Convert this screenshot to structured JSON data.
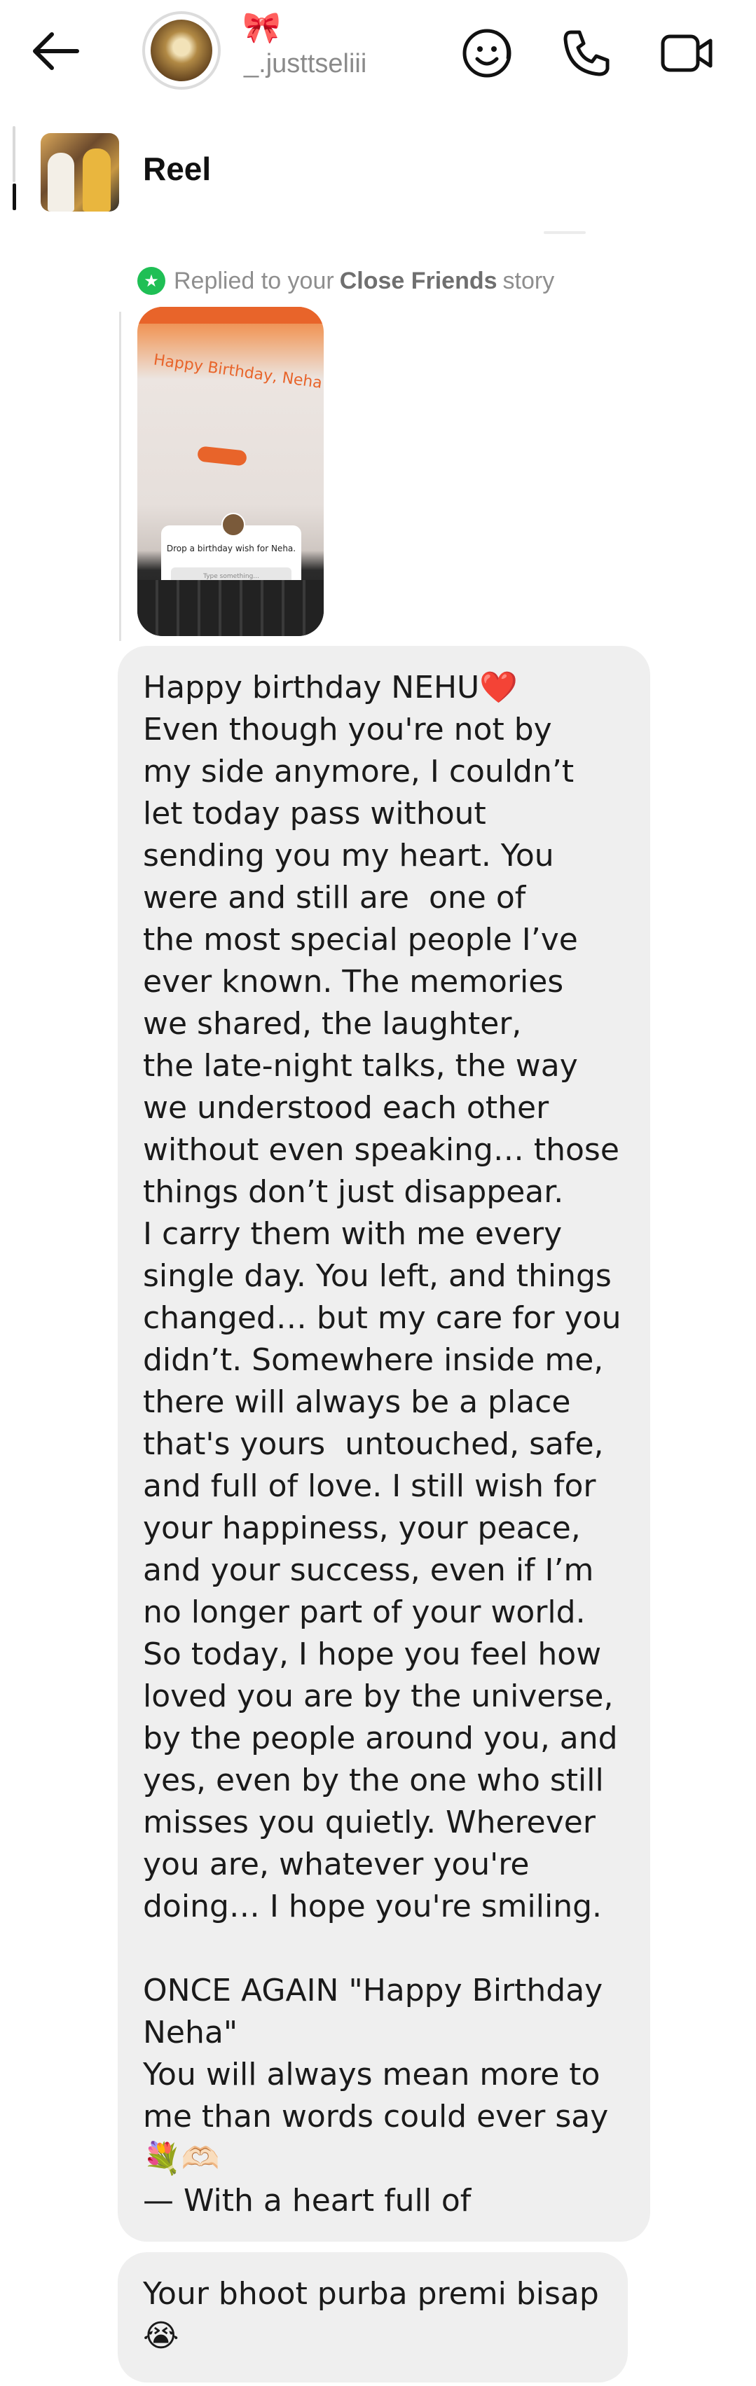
{
  "header": {
    "username": "_.justtseliii",
    "name_emoji": "🎀"
  },
  "reel_preview": {
    "label": "Reel"
  },
  "reply_context": {
    "prefix": "Replied to your",
    "highlight": "Close Friends",
    "suffix": "story",
    "badge_icon": "★"
  },
  "story_thumbnail": {
    "headline": "Happy Birthday, Neha ❤",
    "card_text": "Drop a birthday wish for Neha.",
    "card_placeholder": "Type something..."
  },
  "messages": [
    {
      "text": "Happy birthday NEHU❤️\nEven though you're not by\nmy side anymore, I couldn’t\nlet today pass without\nsending you my heart. You\nwere and still are  one of\nthe most special people I’ve\never known. The memories\nwe shared, the laughter,\nthe late-night talks, the way\nwe understood each other\nwithout even speaking… those\nthings don’t just disappear.\nI carry them with me every\nsingle day. You left, and things\nchanged… but my care for you\ndidn’t. Somewhere inside me,\nthere will always be a place\nthat's yours  untouched, safe,\nand full of love. I still wish for\nyour happiness, your peace,\nand your success, even if I’m\nno longer part of your world.\nSo today, I hope you feel how\nloved you are by the universe,\nby the people around you, and\nyes, even by the one who still\nmisses you quietly. Wherever\nyou are, whatever you're\ndoing… I hope you're smiling.\n\nONCE AGAIN \"Happy Birthday\nNeha\"\nYou will always mean more to\nme than words could ever say\n💐🫶🏻\n— With a heart full of"
    },
    {
      "text": "Your bhoot purba premi bisap\n😭"
    }
  ],
  "colors": {
    "bubble": "#efefef",
    "badge": "#1fbf55",
    "muted_text": "#8e8e8e"
  },
  "icons": {
    "back": "arrow-left-icon",
    "sticker": "sticker-face-icon",
    "call": "phone-icon",
    "video": "video-camera-icon"
  }
}
